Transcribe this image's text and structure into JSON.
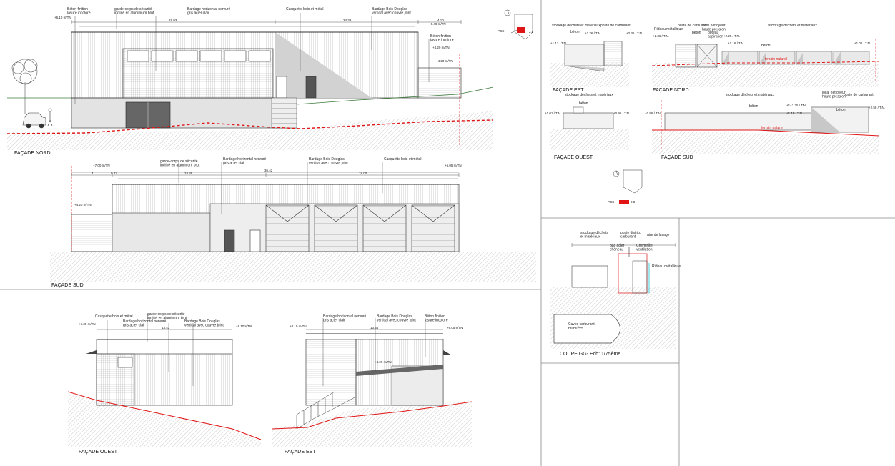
{
  "colors": {
    "line": "#3a3a3a",
    "blue": "#1f2fd0",
    "red": "#e01515",
    "cyan": "#19c6d8",
    "hatch": "#b8b8b8",
    "fill": "#e4e4e4"
  },
  "nord": {
    "title": "FAÇADE NORD",
    "labels": [
      "Béton finition\nlasure incolore",
      "garde-corps de sécurité\nincliné en aluminium brut",
      "Bardage horizontal nervuré\ngris acier clair",
      "Casquette bois et métal",
      "Bardage Bois Douglas\nvertical avec couvre joint",
      "Béton finition\nlasure incolore"
    ],
    "levels": [
      "+6.10 m/TN",
      "+6.40 m/TN",
      "+4.20 m/TN",
      "+4.20 m/TN"
    ],
    "dims": [
      "19.93",
      "24.39",
      "4.10",
      "2.8",
      "8.9"
    ],
    "limit": "limite de propriété"
  },
  "sud": {
    "title": "FAÇADE SUD",
    "labels": [
      "garde-corps de sécurité\nincliné en aluminium brut",
      "Bardage horizontal nervuré\ngris acier clair",
      "Bardage Bois Douglas\nvertical avec couvre joint",
      "Casquette bois et métal"
    ],
    "levels": [
      "+7.00 m/TN",
      "+6.05 m/TN",
      "+4.20 m/TN"
    ],
    "dims": [
      "4",
      "0.22",
      "24.39",
      "36.42",
      "18.00",
      "6.35",
      "6.40",
      "4.90"
    ],
    "limit": "limite de propriété"
  },
  "ouest": {
    "title": "FAÇADE OUEST",
    "labels": [
      "Casquette bois et métal",
      "garde-corps de sécurité\nincliné en aluminium brut",
      "Bardage horizontal nervuré\ngris acier clair",
      "Bardage Bois Douglas\nvertical avec couvre joint"
    ],
    "levels": [
      "+6.05 m/TN",
      "+9.10m/TN"
    ],
    "dims": [
      "13.43",
      "6.8"
    ]
  },
  "est": {
    "title": "FAÇADE EST",
    "labels": [
      "Bardage horizontal nervuré\ngris acier clair",
      "Bardage Bois Douglas\nvertical avec couvre joint",
      "Béton finition\nlasure incolore"
    ],
    "levels": [
      "+8.10 m/TN",
      "+6.05m/TN",
      "+4.20 m/TN"
    ],
    "dims": [
      "13.34",
      "2.25",
      "3.60"
    ]
  },
  "kiosk_est": {
    "title": "FAÇADE EST",
    "labels": [
      "stockage déchets et matériaux",
      "poste de carburant",
      "béton"
    ],
    "levels": [
      "+2.26 / T.N.",
      "+2.36 / T.N.",
      "+1.12 / T.N."
    ],
    "dims": [
      "3.2",
      "1.8",
      "1.12"
    ]
  },
  "kiosk_nord": {
    "title": "FAÇADE NORD",
    "labels": [
      "Rideau métallique",
      "poste de carburant",
      "local nettoyeur\nhaute pression",
      "stockage déchets et matériaux",
      "béton",
      "poteau\naspiration",
      "béton",
      "terrain naturel"
    ],
    "levels": [
      "+2.36 / T.N.",
      "+2.25 / T.N.",
      "+1.16 / T.N.",
      "+1.01 / T.N."
    ],
    "dims": [
      "5.4",
      "14.7",
      "2.6"
    ],
    "limit": "limite de propriété"
  },
  "kiosk_ouest": {
    "title": "FAÇADE OUEST",
    "labels": [
      "stockage déchets et matériaux",
      "béton"
    ],
    "levels": [
      "+1.01 / T.N.",
      "+0.95 / T.N."
    ]
  },
  "kiosk_sud": {
    "title": "FAÇADE SUD",
    "labels": [
      "stockage déchets et matériaux",
      "local nettoyeur\nhaute pression",
      "poste de carburant",
      "béton",
      "béton",
      "terrain naturel"
    ],
    "levels": [
      "+0.96 / T.N.",
      "+1+2.25 / T.N.",
      "+1.19 / T.N.",
      "+2.59 / T.N."
    ],
    "dims": [
      "2.6"
    ],
    "limit": "limite de propriété"
  },
  "coupe": {
    "title": "COUPE GG- Ech: 1/75ème",
    "headers": [
      "stockage déchets\net matériaux",
      "poste distrib.\ncarburant",
      "aire de lavage"
    ],
    "labels": [
      "bac acier\nchéneau",
      "Cheminée\nventilation",
      "Rideau métallique",
      "Cuves carburant\nenterrées"
    ],
    "dims": [
      "2.9",
      "1.27"
    ]
  },
  "keyplan": {
    "labels": [
      "P.6C",
      "2.8",
      "P.6",
      "P.6C",
      "2.8"
    ]
  }
}
